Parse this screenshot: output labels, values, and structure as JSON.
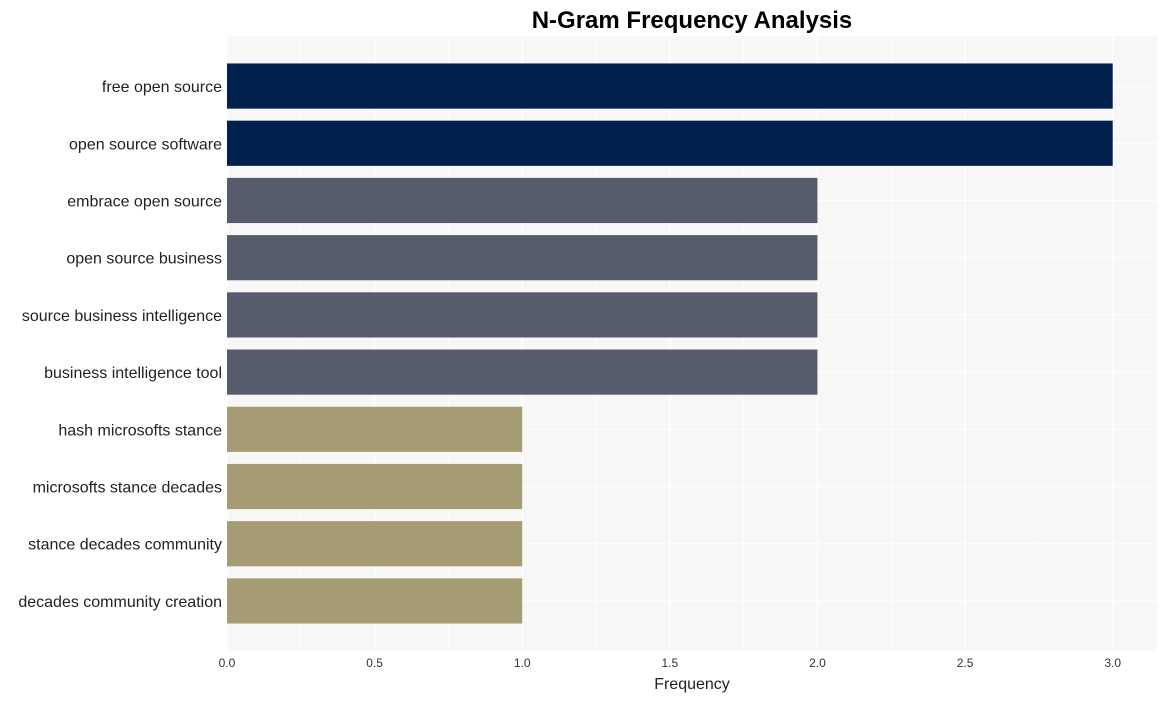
{
  "chart_data": {
    "type": "bar",
    "orientation": "horizontal",
    "title": "N-Gram Frequency Analysis",
    "xlabel": "Frequency",
    "ylabel": "",
    "xlim": [
      0,
      3.15
    ],
    "xticks": [
      0.0,
      0.5,
      1.0,
      1.5,
      2.0,
      2.5,
      3.0
    ],
    "xtick_labels": [
      "0.0",
      "0.5",
      "1.0",
      "1.5",
      "2.0",
      "2.5",
      "3.0"
    ],
    "grid": true,
    "categories": [
      "free open source",
      "open source software",
      "embrace open source",
      "open source business",
      "source business intelligence",
      "business intelligence tool",
      "hash microsofts stance",
      "microsofts stance decades",
      "stance decades community",
      "decades community creation"
    ],
    "values": [
      3,
      3,
      2,
      2,
      2,
      2,
      1,
      1,
      1,
      1
    ],
    "colors": {
      "3": "#00214d",
      "2": "#575c6d",
      "1": "#a59c74"
    },
    "background": "#f7f7f7",
    "gridline_color": "#ffffff"
  }
}
